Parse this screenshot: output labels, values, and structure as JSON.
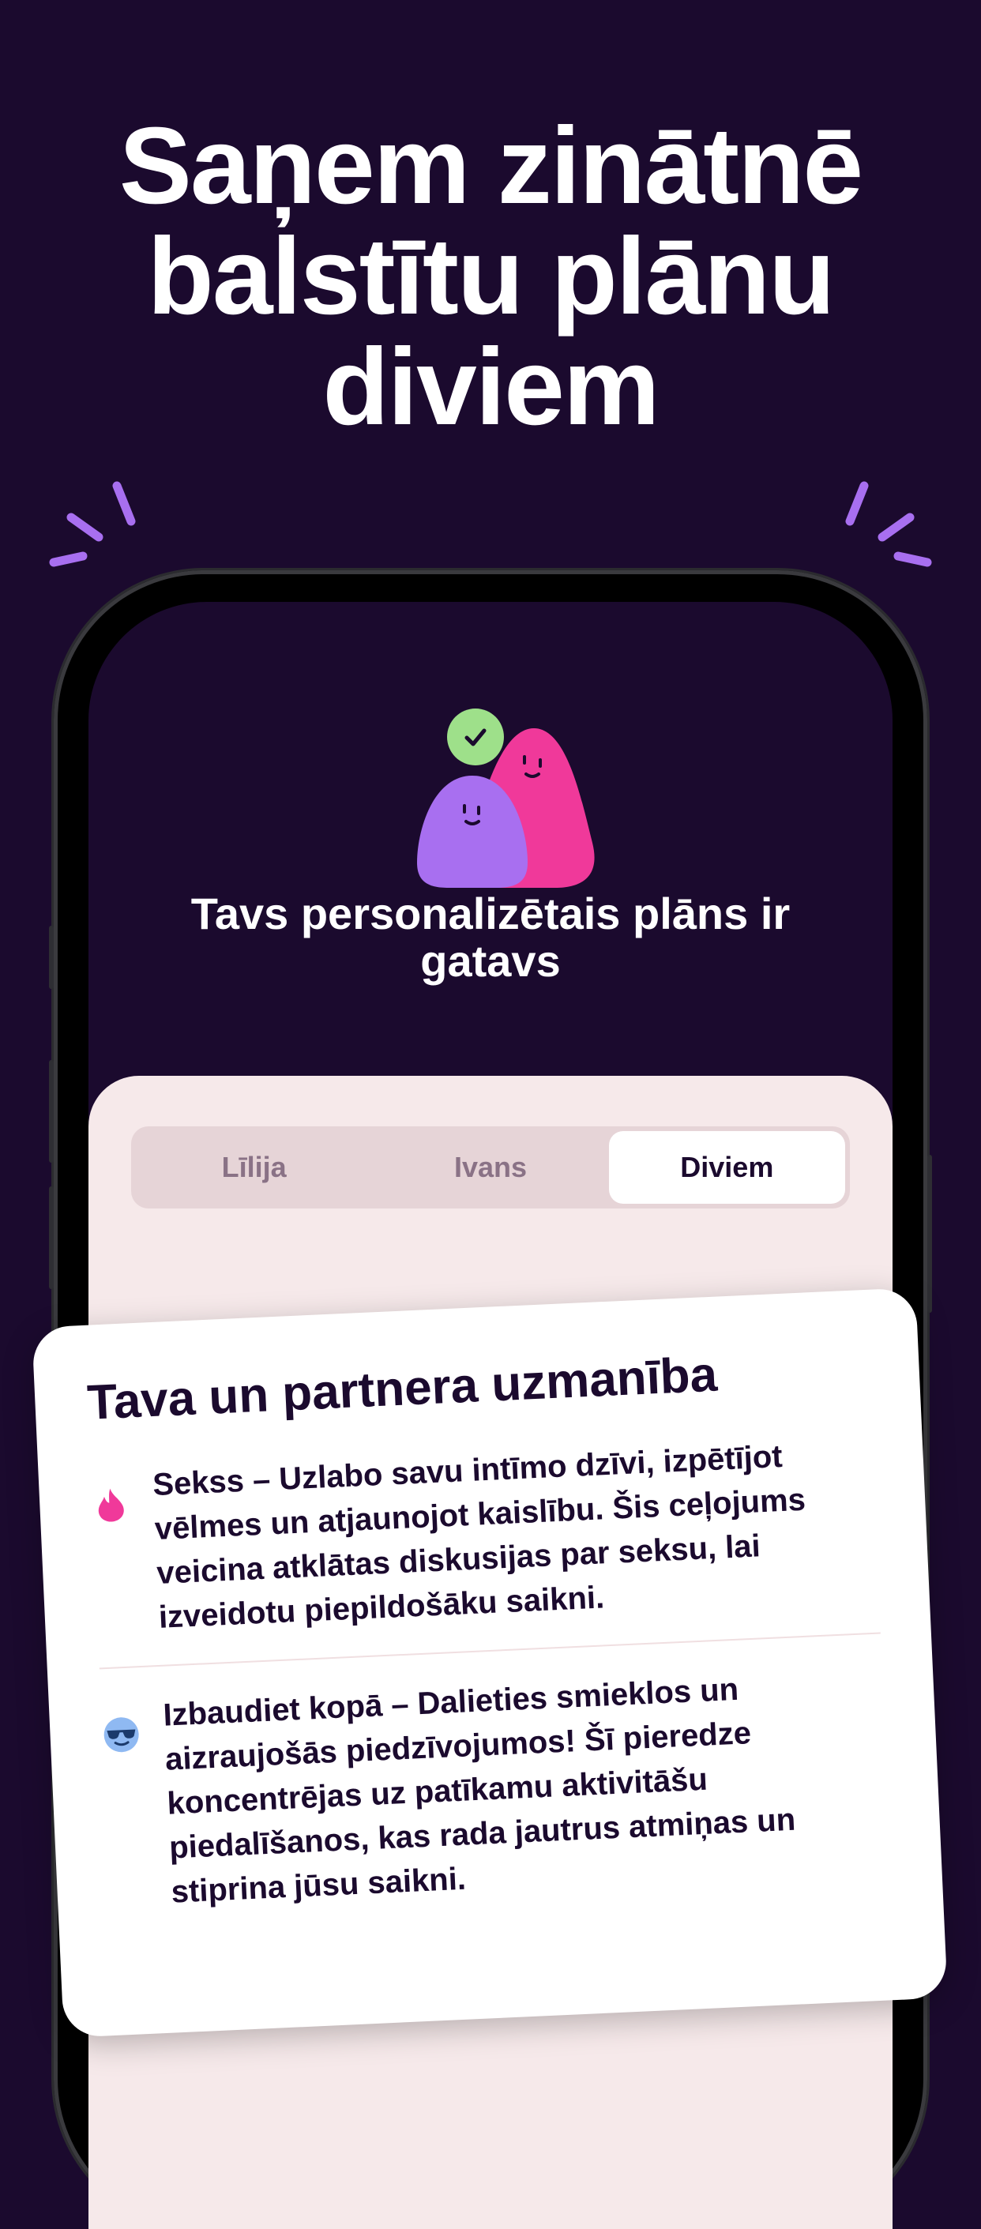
{
  "headline": "Saņem zinātnē balstītu plānu diviem",
  "app": {
    "ready_title": "Tavs personalizētais plāns ir gatavs",
    "tabs": [
      {
        "label": "Līlija",
        "active": false
      },
      {
        "label": "Ivans",
        "active": false
      },
      {
        "label": "Diviem",
        "active": true
      }
    ]
  },
  "card": {
    "title": "Tava un partnera uzmanība",
    "items": [
      {
        "icon": "flame-icon",
        "text": "Sekss – Uzlabo savu intīmo dzīvi, izpētījot vēlmes un atjaunojot kaislību. Šis ceļojums veicina atklātas diskusijas par seksu, lai izveidotu piepildošāku saikni."
      },
      {
        "icon": "sunglasses-face-icon",
        "text": "Izbaudiet kopā – Dalieties smieklos un aizraujošās piedzīvojumos! Šī pieredze koncentrējas uz patīkamu aktivitāšu piedalīšanos, kas rada jautrus atmiņas un stiprina jūsu saikni."
      }
    ]
  },
  "colors": {
    "background": "#1b0a2e",
    "sheet": "#f6e9ea",
    "accent_purple": "#a86ff0",
    "accent_pink": "#f0399a",
    "check_green": "#9ee08a"
  }
}
